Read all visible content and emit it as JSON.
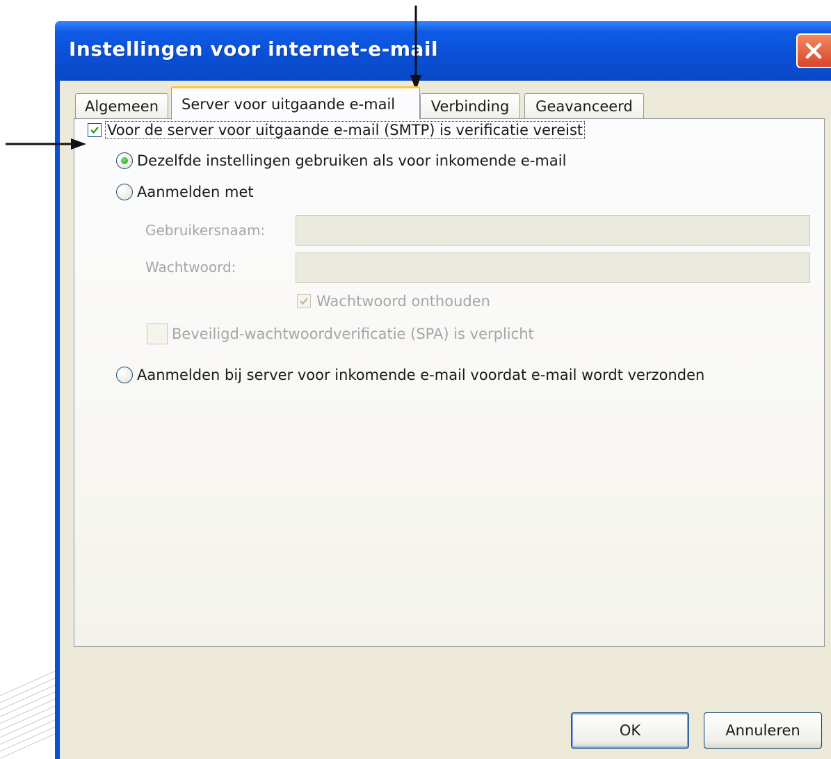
{
  "window": {
    "title": "Instellingen voor internet-e-mail"
  },
  "tabs": [
    {
      "label": "Algemeen",
      "active": false
    },
    {
      "label": "Server voor uitgaande e-mail",
      "active": true
    },
    {
      "label": "Verbinding",
      "active": false
    },
    {
      "label": "Geavanceerd",
      "active": false
    }
  ],
  "panel": {
    "smtp_auth_checkbox": {
      "label": "Voor de server voor uitgaande e-mail (SMTP) is verificatie vereist",
      "checked": true
    },
    "radio_same_settings": {
      "label": "Dezelfde instellingen gebruiken als voor inkomende e-mail",
      "selected": true
    },
    "radio_login_with": {
      "label": "Aanmelden met",
      "selected": false
    },
    "username": {
      "label": "Gebruikersnaam:",
      "value": ""
    },
    "password": {
      "label": "Wachtwoord:",
      "value": ""
    },
    "remember_password": {
      "label": "Wachtwoord onthouden",
      "checked": true,
      "disabled": true
    },
    "spa_required": {
      "label": "Beveiligd-wachtwoordverificatie (SPA) is verplicht",
      "checked": false,
      "disabled": true
    },
    "radio_login_incoming_first": {
      "label": "Aanmelden bij server voor inkomende e-mail voordat e-mail wordt verzonden",
      "selected": false
    }
  },
  "buttons": {
    "ok": "OK",
    "cancel": "Annuleren"
  },
  "colors": {
    "titlebar": "#0a4fd6",
    "dialog_bg": "#ece9d8",
    "active_tab_accent": "#ffc83c",
    "radio_dot": "#21a121"
  },
  "icons": {
    "close": "close-icon",
    "checkmark": "checkmark-icon",
    "arrow": "arrow-icon"
  }
}
